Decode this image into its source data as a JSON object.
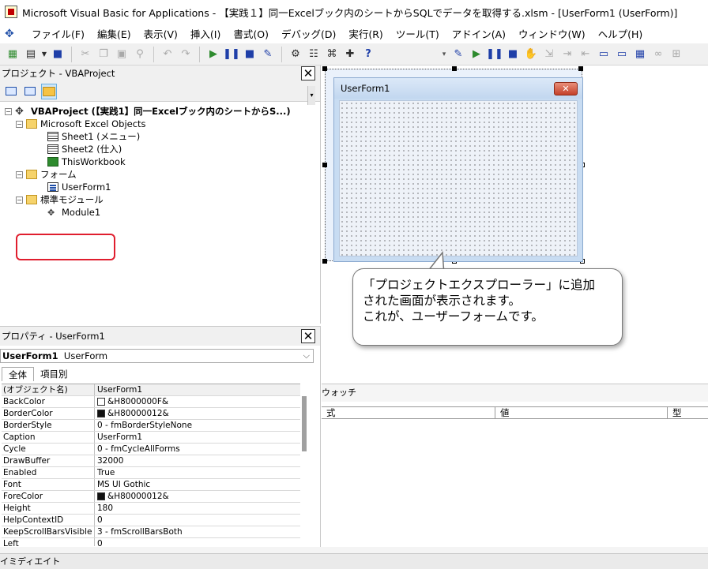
{
  "window": {
    "title": "Microsoft Visual Basic for Applications - 【実践１】同一Excelブック内のシートからSQLでデータを取得する.xlsm - [UserForm1 (UserForm)]"
  },
  "menu": {
    "items": [
      "ファイル(F)",
      "編集(E)",
      "表示(V)",
      "挿入(I)",
      "書式(O)",
      "デバッグ(D)",
      "実行(R)",
      "ツール(T)",
      "アドイン(A)",
      "ウィンドウ(W)",
      "ヘルプ(H)"
    ]
  },
  "toolbar": {
    "icons": [
      "excel-icon",
      "insert-form-icon",
      "save-icon",
      "cut-icon",
      "copy-icon",
      "paste-icon",
      "find-icon",
      "undo-icon",
      "redo-icon",
      "run-icon",
      "break-icon",
      "reset-icon",
      "design-mode-icon",
      "project-explorer-icon",
      "properties-icon",
      "object-browser-icon",
      "toolbox-icon",
      "help-icon"
    ]
  },
  "project": {
    "header": "プロジェクト - VBAProject",
    "tree": {
      "root": "VBAProject (【実践1】同一Excelブック内のシートからS...)",
      "excel_objects": "Microsoft Excel Objects",
      "sheet1": "Sheet1 (メニュー)",
      "sheet2": "Sheet2 (仕入)",
      "thisworkbook": "ThisWorkbook",
      "forms": "フォーム",
      "userform1": "UserForm1",
      "modules": "標準モジュール",
      "module1": "Module1"
    }
  },
  "properties": {
    "header": "プロパティ - UserForm1",
    "object_name": "UserForm1",
    "object_type": "UserForm",
    "tabs": [
      "全体",
      "項目別"
    ],
    "rows": [
      {
        "name": "(オブジェクト名)",
        "value": "UserForm1"
      },
      {
        "name": "BackColor",
        "value": "&H8000000F&",
        "swatch": "white"
      },
      {
        "name": "BorderColor",
        "value": "&H80000012&",
        "swatch": "black"
      },
      {
        "name": "BorderStyle",
        "value": "0 - fmBorderStyleNone"
      },
      {
        "name": "Caption",
        "value": "UserForm1"
      },
      {
        "name": "Cycle",
        "value": "0 - fmCycleAllForms"
      },
      {
        "name": "DrawBuffer",
        "value": "32000"
      },
      {
        "name": "Enabled",
        "value": "True"
      },
      {
        "name": "Font",
        "value": "MS UI Gothic"
      },
      {
        "name": "ForeColor",
        "value": "&H80000012&",
        "swatch": "black"
      },
      {
        "name": "Height",
        "value": "180"
      },
      {
        "name": "HelpContextID",
        "value": "0"
      },
      {
        "name": "KeepScrollBarsVisible",
        "value": "3 - fmScrollBarsBoth"
      },
      {
        "name": "Left",
        "value": "0"
      }
    ]
  },
  "designer": {
    "form_title": "UserForm1",
    "close_glyph": "✕"
  },
  "callout": {
    "lines": [
      "「プロジェクトエクスプローラー」に追加",
      "された画面が表示されます。",
      "これが、ユーザーフォームです。"
    ]
  },
  "watch": {
    "title": "ウォッチ",
    "columns": [
      "式",
      "値",
      "型"
    ]
  },
  "immediate": {
    "title": "イミディエイト"
  }
}
